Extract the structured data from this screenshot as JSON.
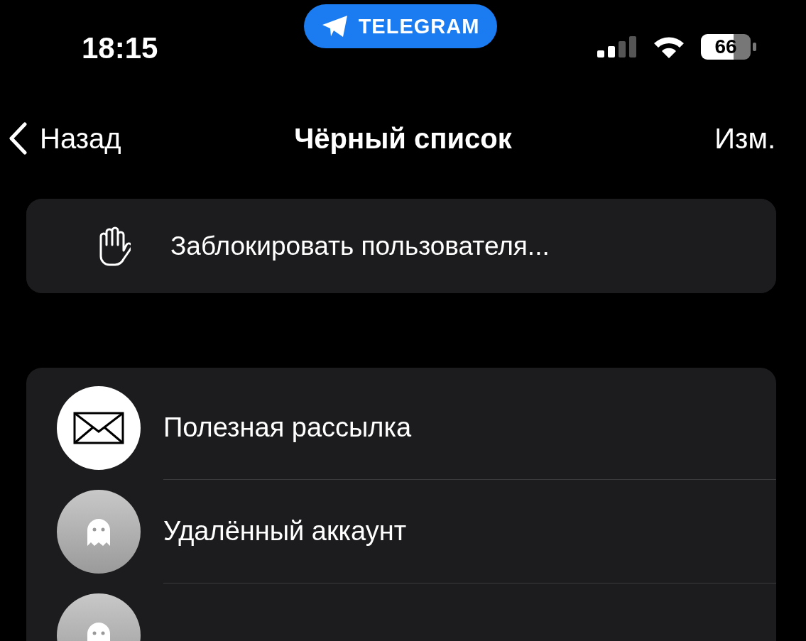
{
  "status_bar": {
    "time": "18:15",
    "app_pill": "TELEGRAM",
    "battery": "66"
  },
  "nav": {
    "back": "Назад",
    "title": "Чёрный список",
    "edit": "Изм."
  },
  "block_action": {
    "label": "Заблокировать пользователя..."
  },
  "blocked": [
    {
      "kind": "mail",
      "name": "Полезная рассылка"
    },
    {
      "kind": "deleted",
      "name": "Удалённый аккаунт"
    },
    {
      "kind": "deleted"
    }
  ]
}
